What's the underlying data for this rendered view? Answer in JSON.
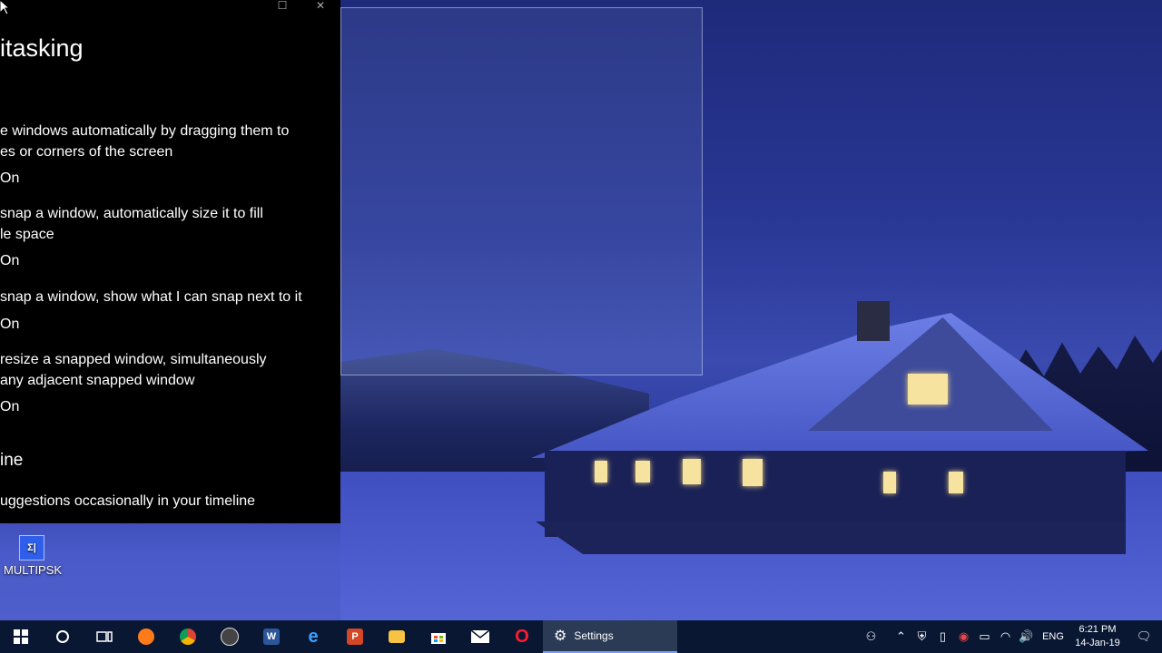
{
  "settings_window": {
    "page_title": "itasking",
    "options": [
      {
        "text_line1": "e windows automatically by dragging them to",
        "text_line2": "es or corners of the screen",
        "state": "On"
      },
      {
        "text_line1": "snap a window, automatically size it to fill",
        "text_line2": "le space",
        "state": "On"
      },
      {
        "text_line1": "snap a window, show what I can snap next to it",
        "text_line2": "",
        "state": "On"
      },
      {
        "text_line1": "resize a snapped window, simultaneously",
        "text_line2": "any adjacent snapped window",
        "state": "On"
      }
    ],
    "section_title": "ine",
    "section_text": "uggestions occasionally in your timeline"
  },
  "desktop": {
    "icons": [
      {
        "label": "MULTIPSK",
        "icon": "multipsk-icon",
        "glyph": "Σ|"
      }
    ]
  },
  "taskbar": {
    "active_app_label": "Settings",
    "apps": [
      {
        "name": "start-button",
        "icon": "windows-icon"
      },
      {
        "name": "cortana-button",
        "icon": "circle-icon"
      },
      {
        "name": "task-view-button",
        "icon": "task-view-icon"
      },
      {
        "name": "firefox",
        "icon": "firefox-icon",
        "color": "#ff7a18"
      },
      {
        "name": "chrome",
        "icon": "chrome-icon",
        "color": "#2a9d4a"
      },
      {
        "name": "obs",
        "icon": "obs-icon",
        "color": "#444"
      },
      {
        "name": "word",
        "icon": "word-icon",
        "color": "#2b579a",
        "glyph": "W"
      },
      {
        "name": "edge",
        "icon": "edge-icon",
        "color": "#1f7ad6",
        "glyph": "e"
      },
      {
        "name": "powerpoint",
        "icon": "powerpoint-icon",
        "color": "#d24726",
        "glyph": "P"
      },
      {
        "name": "file-explorer",
        "icon": "folder-icon",
        "color": "#f6c343"
      },
      {
        "name": "store",
        "icon": "store-icon",
        "color": "#ffffff"
      },
      {
        "name": "mail",
        "icon": "mail-icon",
        "color": "#ffffff"
      },
      {
        "name": "opera",
        "icon": "opera-icon",
        "color": "#ff1b2d",
        "glyph": "O"
      }
    ],
    "tray": {
      "language": "ENG",
      "time": "6:21 PM",
      "date": "14-Jan-19"
    }
  }
}
